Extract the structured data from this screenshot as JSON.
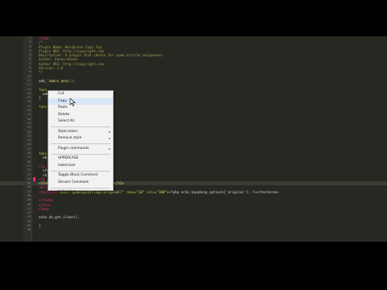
{
  "editor": {
    "lines": [
      {
        "n": "1",
        "segments": [
          {
            "c": "c-kw",
            "t": "<?php"
          }
        ]
      },
      {
        "n": "2",
        "segments": [
          {
            "c": "c-com",
            "t": "/*"
          }
        ]
      },
      {
        "n": "3",
        "segments": [
          {
            "c": "c-com",
            "t": "Plugin Name: Wordpress Copy Cop"
          }
        ]
      },
      {
        "n": "4",
        "segments": [
          {
            "c": "c-com",
            "t": "Plugin URI: http://copyright.com"
          }
        ]
      },
      {
        "n": "5",
        "segments": [
          {
            "c": "c-com",
            "t": "Description: A plugin that checks for spam article uniqueness."
          }
        ]
      },
      {
        "n": "6",
        "segments": [
          {
            "c": "c-com",
            "t": "Author: Danny Kehoe"
          }
        ]
      },
      {
        "n": "7",
        "segments": [
          {
            "c": "c-com",
            "t": "Author URI: http://copyright.com"
          }
        ]
      },
      {
        "n": "8",
        "segments": [
          {
            "c": "c-com",
            "t": "Version: 1.0"
          }
        ]
      },
      {
        "n": "9",
        "segments": [
          {
            "c": "c-com",
            "t": "*/"
          }
        ]
      },
      {
        "n": "10",
        "segments": []
      },
      {
        "n": "11",
        "segments": [
          {
            "c": "",
            "t": "add_"
          },
          {
            "c": "c-str",
            "t": "'admin_menu'"
          },
          {
            "c": "",
            "t": ");"
          }
        ]
      },
      {
        "n": "12",
        "segments": []
      },
      {
        "n": "13",
        "segments": [
          {
            "c": "c-fn",
            "t": "func"
          }
        ]
      },
      {
        "n": "14",
        "segments": [
          {
            "c": "",
            "t": "  add_o"
          },
          {
            "c": "c-str",
            "t": "'  ', 'spamcopsettings'"
          },
          {
            "c": "",
            "t": ");"
          }
        ]
      },
      {
        "n": "15",
        "segments": [
          {
            "c": "",
            "t": "}"
          }
        ]
      },
      {
        "n": "16",
        "segments": []
      },
      {
        "n": "17",
        "segments": [
          {
            "c": "c-fn",
            "t": "func"
          }
        ]
      },
      {
        "n": "18",
        "segments": []
      },
      {
        "n": "19",
        "segments": []
      },
      {
        "n": "20",
        "segments": []
      },
      {
        "n": "21",
        "segments": []
      },
      {
        "n": "22",
        "segments": []
      },
      {
        "n": "23",
        "segments": []
      },
      {
        "n": "24",
        "segments": []
      },
      {
        "n": "25",
        "segments": []
      },
      {
        "n": "26",
        "segments": []
      },
      {
        "n": "27",
        "segments": []
      },
      {
        "n": "28",
        "segments": [
          {
            "c": "c-fn",
            "t": "func"
          }
        ]
      },
      {
        "n": "29",
        "segments": [
          {
            "c": "",
            "t": "  ob_"
          }
        ]
      },
      {
        "n": "30",
        "segments": []
      },
      {
        "n": "31",
        "segments": [
          {
            "c": "tag",
            "t": "<?p"
          }
        ]
      },
      {
        "n": "32",
        "segments": [
          {
            "c": "",
            "t": "  <fo"
          },
          {
            "c": "val",
            "t": "\"POST\""
          },
          {
            "c": "",
            "t": ">"
          }
        ]
      },
      {
        "n": "33",
        "segments": [
          {
            "c": "",
            "t": "  <h"
          }
        ]
      },
      {
        "n": "34",
        "segments": [
          {
            "c": "c-kw",
            "t": "<?p"
          }
        ]
      },
      {
        "n": "35",
        "segments": [
          {
            "c": "c-str",
            "t": "<h3>Enter your original article here.</h3>"
          }
        ]
      },
      {
        "n": "36",
        "segments": [
          {
            "c": "tag",
            "t": "<br/>"
          }
        ]
      },
      {
        "n": "37",
        "segments": [
          {
            "c": "tag",
            "t": "<textarea "
          },
          {
            "c": "attr",
            "t": "name="
          },
          {
            "c": "val",
            "t": "\"spamcopsettings[original]\""
          },
          {
            "c": "attr",
            "t": " rows="
          },
          {
            "c": "val",
            "t": "\"10\""
          },
          {
            "c": "attr",
            "t": " cols="
          },
          {
            "c": "val",
            "t": "\"100\""
          },
          {
            "c": "",
            "t": "><?php echo $spamcop_options['original']; ?></textarea>"
          }
        ]
      },
      {
        "n": "38",
        "segments": []
      },
      {
        "n": "39",
        "segments": [
          {
            "c": "tag",
            "t": "</form>"
          }
        ]
      },
      {
        "n": "40",
        "segments": [
          {
            "c": "tag",
            "t": "</div>"
          }
        ]
      },
      {
        "n": "41",
        "segments": [
          {
            "c": "c-kw",
            "t": "<?php"
          }
        ]
      },
      {
        "n": "42",
        "segments": []
      },
      {
        "n": "43",
        "segments": [
          {
            "c": "",
            "t": "echo ob_get_clean();"
          }
        ]
      },
      {
        "n": "44",
        "segments": []
      },
      {
        "n": "45",
        "segments": [
          {
            "c": "",
            "t": "}"
          }
        ]
      },
      {
        "n": "46",
        "segments": []
      }
    ]
  },
  "context_menu": {
    "items": [
      {
        "label": "Cut"
      },
      {
        "label": "Copy",
        "active": true
      },
      {
        "label": "Paste"
      },
      {
        "label": "Delete"
      },
      {
        "label": "Select All"
      },
      {
        "sep": true
      },
      {
        "label": "Style token",
        "submenu": true
      },
      {
        "label": "Remove style",
        "submenu": true
      },
      {
        "sep": true
      },
      {
        "label": "Plugin commands",
        "submenu": true
      },
      {
        "sep": true
      },
      {
        "label": "UPPERCASE"
      },
      {
        "label": "lowercase"
      },
      {
        "sep": true
      },
      {
        "label": "Toggle Block Comment"
      },
      {
        "label": "Stream Comment"
      },
      {
        "sep": true
      },
      {
        "label": "Hide Lines"
      }
    ],
    "submenu_arrow": "▸"
  }
}
